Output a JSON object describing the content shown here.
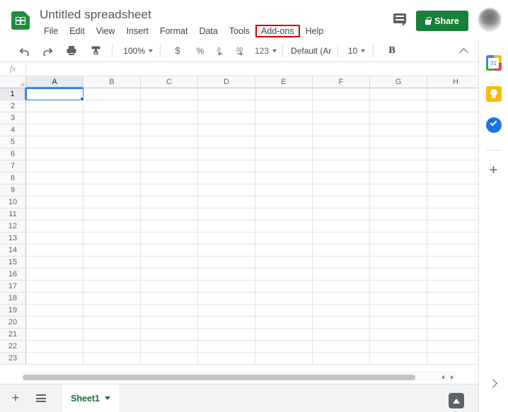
{
  "header": {
    "doc_icon": "sheets-doc-icon",
    "title": "Untitled spreadsheet",
    "menus": [
      {
        "label": "File",
        "highlighted": false
      },
      {
        "label": "Edit",
        "highlighted": false
      },
      {
        "label": "View",
        "highlighted": false
      },
      {
        "label": "Insert",
        "highlighted": false
      },
      {
        "label": "Format",
        "highlighted": false
      },
      {
        "label": "Data",
        "highlighted": false
      },
      {
        "label": "Tools",
        "highlighted": false
      },
      {
        "label": "Add-ons",
        "highlighted": true
      },
      {
        "label": "Help",
        "highlighted": false
      }
    ],
    "comment_icon": "comment-icon",
    "share_label": "Share",
    "share_color": "#188038",
    "highlight_color": "#cc0000",
    "avatar": "user-avatar"
  },
  "toolbar": {
    "undo": "undo-icon",
    "redo": "redo-icon",
    "print": "print-icon",
    "paint_format": "paint-format-icon",
    "zoom_value": "100%",
    "currency": "$",
    "percent": "%",
    "decrease_decimal": ".0",
    "increase_decimal": ".00",
    "number_format": "123",
    "font_name": "Default (Ari...",
    "font_size": "10",
    "bold": "B",
    "collapse": "collapse-toolbar-chevron"
  },
  "formula_bar": {
    "fx_label": "fx",
    "value": "",
    "placeholder": ""
  },
  "grid": {
    "columns": [
      "A",
      "B",
      "C",
      "D",
      "E",
      "F",
      "G",
      "H"
    ],
    "rows": [
      "1",
      "2",
      "3",
      "4",
      "5",
      "6",
      "7",
      "8",
      "9",
      "10",
      "11",
      "12",
      "13",
      "14",
      "15",
      "16",
      "17",
      "18",
      "19",
      "20",
      "21",
      "22",
      "23"
    ],
    "selected_cell": "A1",
    "selected_column": "A",
    "selected_row": "1",
    "selection_color": "#1a73e8"
  },
  "sheet_bar": {
    "add_sheet": "add-sheet-icon",
    "all_sheets": "all-sheets-icon",
    "tabs": [
      {
        "label": "Sheet1",
        "active": true
      }
    ],
    "tab_color": "#137333",
    "explore": "explore-button"
  },
  "side_panel": {
    "items": [
      {
        "name": "google-calendar-icon",
        "label": "31"
      },
      {
        "name": "google-keep-icon",
        "label": ""
      },
      {
        "name": "google-tasks-icon",
        "label": ""
      }
    ],
    "add_on_plus": "+",
    "expand": "expand-side-panel-chevron"
  }
}
